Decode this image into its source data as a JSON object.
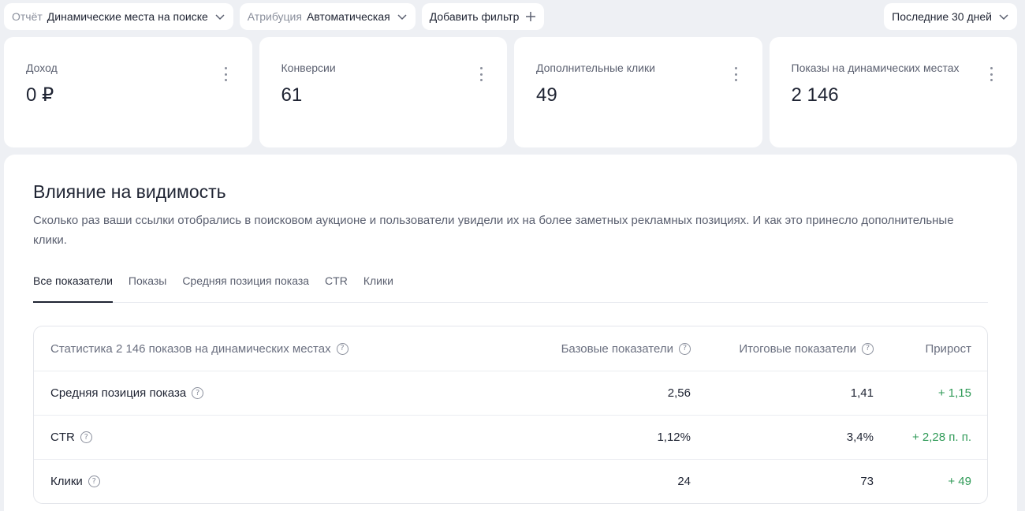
{
  "filters": {
    "report": {
      "label": "Отчёт",
      "value": "Динамические места на поиске"
    },
    "attribution": {
      "label": "Атрибуция",
      "value": "Автоматическая"
    },
    "add_filter": "Добавить фильтр",
    "period": "Последние 30 дней"
  },
  "kpis": [
    {
      "label": "Доход",
      "value": "0 ₽"
    },
    {
      "label": "Конверсии",
      "value": "61"
    },
    {
      "label": "Дополнительные клики",
      "value": "49"
    },
    {
      "label": "Показы на динамических местах",
      "value": "2 146"
    }
  ],
  "panel": {
    "title": "Влияние на видимость",
    "description": "Сколько раз ваши ссылки отобрались в поисковом аукционе и пользователи увидели их на более заметных рекламных позициях. И как это принесло дополнительные клики.",
    "tabs": [
      "Все показатели",
      "Показы",
      "Средняя позиция показа",
      "CTR",
      "Клики"
    ],
    "active_tab": "Все показатели"
  },
  "table": {
    "header": {
      "name": "Статистика 2 146 показов на динамических местах",
      "base": "Базовые показатели",
      "final": "Итоговые показатели",
      "growth": "Прирост"
    },
    "rows": [
      {
        "name": "Средняя позиция показа",
        "base": "2,56",
        "final": "1,41",
        "growth": "+ 1,15"
      },
      {
        "name": "CTR",
        "base": "1,12%",
        "final": "3,4%",
        "growth": "+ 2,28 п. п."
      },
      {
        "name": "Клики",
        "base": "24",
        "final": "73",
        "growth": "+ 49"
      }
    ]
  },
  "colors": {
    "growth": "#2f9a57",
    "background": "#eef0f4",
    "card": "#ffffff"
  },
  "icons": {
    "chevron": "chevron-down-icon",
    "plus": "plus-icon",
    "menu": "kebab-menu-icon",
    "help": "question-circle-icon"
  }
}
